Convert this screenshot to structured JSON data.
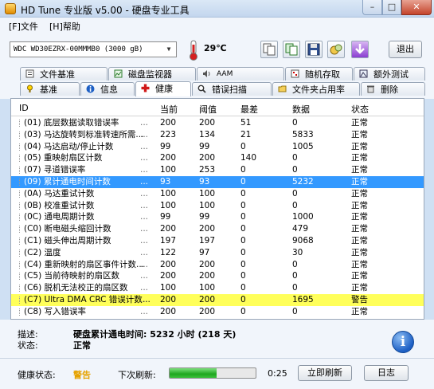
{
  "window": {
    "title": "HD Tune 专业版 v5.00 - 硬盘专业工具"
  },
  "menu": [
    {
      "label": "[F]文件"
    },
    {
      "label": "[H]帮助"
    }
  ],
  "toolbar": {
    "drive": "WDC WD30EZRX-00MMMB0 (3000 gB)",
    "temperature": "29℃",
    "exit_label": "退出",
    "icons": [
      "copy-icon",
      "copy-all-icon",
      "save-icon",
      "screenshot-icon",
      "download-icon"
    ]
  },
  "tabs_row1": [
    {
      "label": "文件基准",
      "icon": "file-benchmark-icon"
    },
    {
      "label": "磁盘监视器",
      "icon": "disk-monitor-icon"
    },
    {
      "label": "AAM",
      "icon": "speaker-icon"
    },
    {
      "label": "随机存取",
      "icon": "random-access-icon"
    },
    {
      "label": "额外测试",
      "icon": "extra-tests-icon"
    }
  ],
  "tabs_row2": [
    {
      "label": "基准",
      "icon": "benchmark-icon"
    },
    {
      "label": "信息",
      "icon": "info-icon"
    },
    {
      "label": "健康",
      "icon": "health-icon",
      "active": true
    },
    {
      "label": "错误扫描",
      "icon": "error-scan-icon"
    },
    {
      "label": "文件夹占用率",
      "icon": "folder-usage-icon"
    },
    {
      "label": "删除",
      "icon": "erase-icon"
    }
  ],
  "table": {
    "columns": [
      "ID",
      "当前",
      "阈值",
      "最差",
      "数据",
      "状态"
    ],
    "rows": [
      {
        "id": "(01) 底层数据读取错误率",
        "current": "200",
        "threshold": "200",
        "worst": "51",
        "data": "0",
        "status": "正常"
      },
      {
        "id": "(03) 马达旋转到标准转速所需...",
        "current": "223",
        "threshold": "134",
        "worst": "21",
        "data": "5833",
        "status": "正常"
      },
      {
        "id": "(04) 马达启动/停止计数",
        "current": "99",
        "threshold": "99",
        "worst": "0",
        "data": "1005",
        "status": "正常"
      },
      {
        "id": "(05) 重映射扇区计数",
        "current": "200",
        "threshold": "200",
        "worst": "140",
        "data": "0",
        "status": "正常"
      },
      {
        "id": "(07) 寻道错误率",
        "current": "100",
        "threshold": "253",
        "worst": "0",
        "data": "0",
        "status": "正常"
      },
      {
        "id": "(09) 累计通电时间计数",
        "current": "93",
        "threshold": "93",
        "worst": "0",
        "data": "5232",
        "status": "正常",
        "selected": true
      },
      {
        "id": "(0A) 马达重试计数",
        "current": "100",
        "threshold": "100",
        "worst": "0",
        "data": "0",
        "status": "正常"
      },
      {
        "id": "(0B) 校准重试计数",
        "current": "100",
        "threshold": "100",
        "worst": "0",
        "data": "0",
        "status": "正常"
      },
      {
        "id": "(0C) 通电周期计数",
        "current": "99",
        "threshold": "99",
        "worst": "0",
        "data": "1000",
        "status": "正常"
      },
      {
        "id": "(C0) 断电磁头缩回计数",
        "current": "200",
        "threshold": "200",
        "worst": "0",
        "data": "479",
        "status": "正常"
      },
      {
        "id": "(C1) 磁头伸出周期计数",
        "current": "197",
        "threshold": "197",
        "worst": "0",
        "data": "9068",
        "status": "正常"
      },
      {
        "id": "(C2) 温度",
        "current": "122",
        "threshold": "97",
        "worst": "0",
        "data": "30",
        "status": "正常"
      },
      {
        "id": "(C4) 重新映射的扇区事件计数...",
        "current": "200",
        "threshold": "200",
        "worst": "0",
        "data": "0",
        "status": "正常"
      },
      {
        "id": "(C5) 当前待映射的扇区数",
        "current": "200",
        "threshold": "200",
        "worst": "0",
        "data": "0",
        "status": "正常"
      },
      {
        "id": "(C6) 脱机无法校正的扇区数",
        "current": "100",
        "threshold": "100",
        "worst": "0",
        "data": "0",
        "status": "正常"
      },
      {
        "id": "(C7) Ultra DMA CRC 错误计数...",
        "current": "200",
        "threshold": "200",
        "worst": "0",
        "data": "1695",
        "status": "警告",
        "warning": true
      },
      {
        "id": "(C8) 写入错误率",
        "current": "200",
        "threshold": "200",
        "worst": "0",
        "data": "0",
        "status": "正常"
      }
    ]
  },
  "description": {
    "desc_label": "描述:",
    "desc_value": "硬盘累计通电时间: 5232 小时 (218 天)",
    "status_label": "状态:",
    "status_value": "正常"
  },
  "statusbar": {
    "health_label": "健康状态:",
    "health_value": "警告",
    "next_refresh_label": "下次刷新:",
    "refresh_progress": 0.55,
    "countdown": "0:25",
    "refresh_button": "立即刷新",
    "log_button": "日志"
  },
  "colors": {
    "selection": "#3399ff",
    "warning_row": "#ffff5a",
    "warning_text": "#e6a200"
  }
}
